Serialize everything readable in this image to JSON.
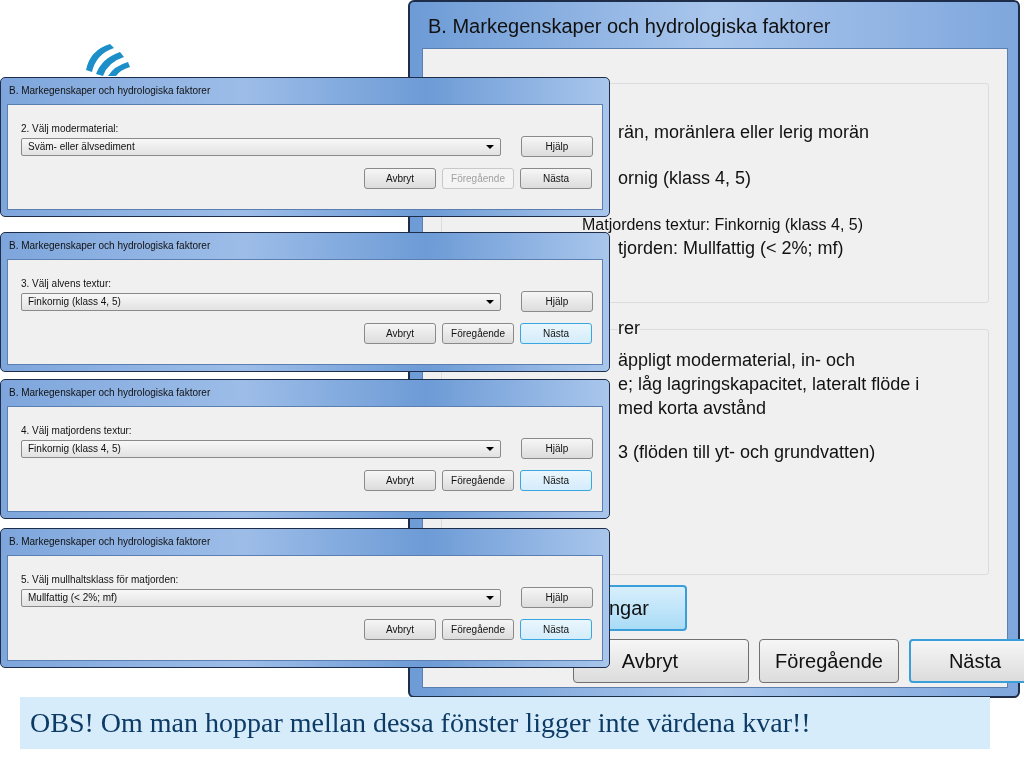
{
  "back_window": {
    "title": "B. Markegenskaper och hydrologiska faktorer",
    "lines": [
      "rän, moränlera eller lerig morän",
      "ornig (klass 4, 5)",
      "Matjordens textur: Finkornig (klass 4, 5)",
      "tjorden: Mullfattig (< 2%; mf)"
    ],
    "group_label": "rer",
    "paragraph": [
      "äppligt modermaterial, in- och",
      "e; låg lagringskapacitet, lateralt flöde i",
      "med korta avstånd"
    ],
    "flow_line": "3 (flöden till yt- och grundvatten)",
    "side_button": "ngar",
    "buttons": [
      {
        "label": "Avbryt",
        "default": false
      },
      {
        "label": "Föregående",
        "default": false
      },
      {
        "label": "Nästa",
        "default": true
      }
    ]
  },
  "dialogs": [
    {
      "title": "B. Markegenskaper och hydrologiska faktorer",
      "prompt": "2. Välj modermaterial:",
      "value": "Sväm- eller älvsediment",
      "help_button": "Hjälp",
      "buttons": [
        {
          "label": "Avbryt",
          "disabled": false,
          "default": false
        },
        {
          "label": "Föregående",
          "disabled": true,
          "default": false
        },
        {
          "label": "Nästa",
          "disabled": false,
          "default": false
        }
      ]
    },
    {
      "title": "B. Markegenskaper och hydrologiska faktorer",
      "prompt": "3. Välj alvens textur:",
      "value": "Finkornig (klass 4, 5)",
      "help_button": "Hjälp",
      "buttons": [
        {
          "label": "Avbryt",
          "disabled": false,
          "default": false
        },
        {
          "label": "Föregående",
          "disabled": false,
          "default": false
        },
        {
          "label": "Nästa",
          "disabled": false,
          "default": true
        }
      ]
    },
    {
      "title": "B. Markegenskaper och hydrologiska faktorer",
      "prompt": "4. Välj matjordens textur:",
      "value": "Finkornig (klass 4, 5)",
      "help_button": "Hjälp",
      "buttons": [
        {
          "label": "Avbryt",
          "disabled": false,
          "default": false
        },
        {
          "label": "Föregående",
          "disabled": false,
          "default": false
        },
        {
          "label": "Nästa",
          "disabled": false,
          "default": true
        }
      ]
    },
    {
      "title": "B. Markegenskaper och hydrologiska faktorer",
      "prompt": "5. Välj mullhaltsklass för matjorden:",
      "value": "Mullfattig (< 2%; mf)",
      "help_button": "Hjälp",
      "buttons": [
        {
          "label": "Avbryt",
          "disabled": false,
          "default": false
        },
        {
          "label": "Föregående",
          "disabled": false,
          "default": false
        },
        {
          "label": "Nästa",
          "disabled": false,
          "default": true
        }
      ]
    }
  ],
  "note": "OBS! Om man hoppar mellan dessa fönster ligger inte värdena kvar!!"
}
